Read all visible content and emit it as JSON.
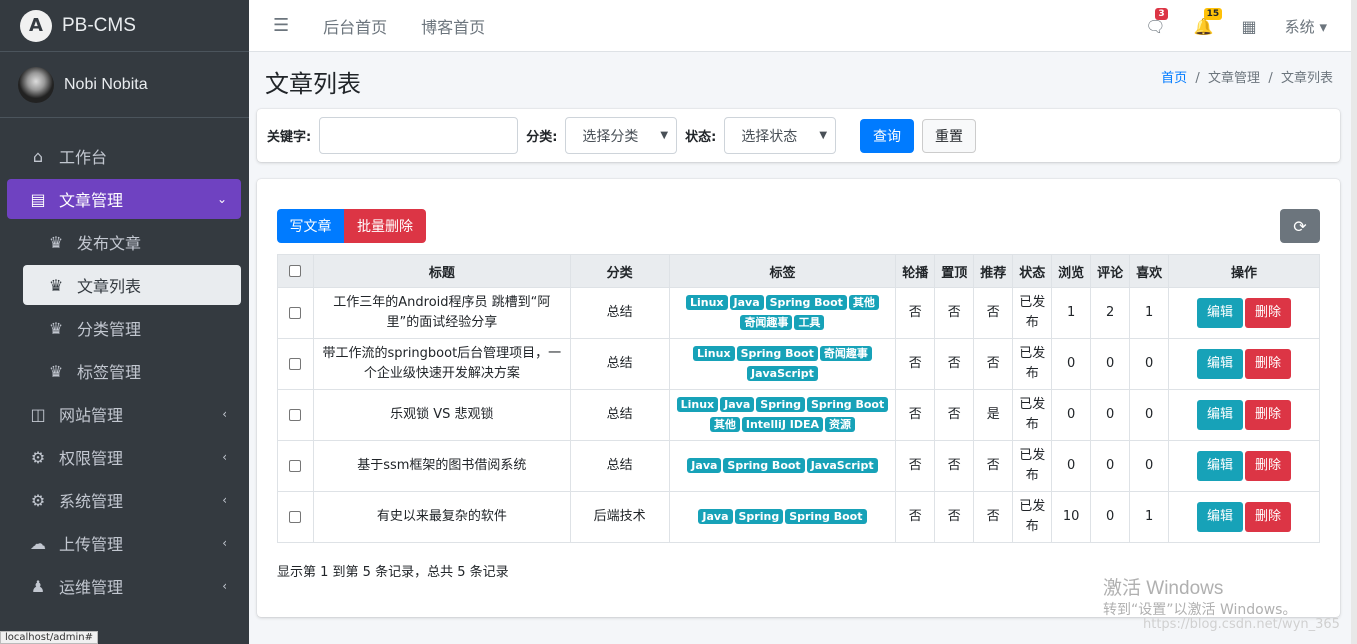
{
  "brand": {
    "name": "PB-CMS"
  },
  "user": {
    "name": "Nobi Nobita"
  },
  "sidebar": {
    "items": [
      {
        "label": "工作台",
        "icon": "home-icon"
      },
      {
        "label": "文章管理",
        "icon": "list-alt-icon"
      },
      {
        "label": "发布文章",
        "icon": "crown-icon"
      },
      {
        "label": "文章列表",
        "icon": "crown-icon"
      },
      {
        "label": "分类管理",
        "icon": "crown-icon"
      },
      {
        "label": "标签管理",
        "icon": "crown-icon"
      },
      {
        "label": "网站管理",
        "icon": "columns-icon"
      },
      {
        "label": "权限管理",
        "icon": "users-cog-icon"
      },
      {
        "label": "系统管理",
        "icon": "gear-icon"
      },
      {
        "label": "上传管理",
        "icon": "cloud-upload-icon"
      },
      {
        "label": "运维管理",
        "icon": "people-carry-icon"
      }
    ]
  },
  "topbar": {
    "links": [
      "后台首页",
      "博客首页"
    ],
    "messages_count": "3",
    "notifications_count": "15",
    "system_label": "系统"
  },
  "page": {
    "title": "文章列表",
    "breadcrumb": [
      "首页",
      "文章管理",
      "文章列表"
    ]
  },
  "filter": {
    "keyword_label": "关键字:",
    "keyword_value": "",
    "category_label": "分类:",
    "category_value": "选择分类",
    "status_label": "状态:",
    "status_value": "选择状态",
    "search_label": "查询",
    "reset_label": "重置"
  },
  "toolbar": {
    "write_label": "写文章",
    "batch_delete_label": "批量删除"
  },
  "table": {
    "headers": [
      "标题",
      "分类",
      "标签",
      "轮播",
      "置顶",
      "推荐",
      "状态",
      "浏览",
      "评论",
      "喜欢",
      "操作"
    ],
    "edit_label": "编辑",
    "delete_label": "删除",
    "rows": [
      {
        "title": "工作三年的Android程序员 跳槽到“阿里”的面试经验分享",
        "category": "总结",
        "tags": [
          "Linux",
          "Java",
          "Spring Boot",
          "其他",
          "奇闻趣事",
          "工具"
        ],
        "carousel": "否",
        "top": "否",
        "recommend": "否",
        "status": "已发布",
        "views": "1",
        "comments": "2",
        "likes": "1"
      },
      {
        "title": "带工作流的springboot后台管理项目，一个企业级快速开发解决方案",
        "category": "总结",
        "tags": [
          "Linux",
          "Spring Boot",
          "奇闻趣事",
          "JavaScript"
        ],
        "carousel": "否",
        "top": "否",
        "recommend": "否",
        "status": "已发布",
        "views": "0",
        "comments": "0",
        "likes": "0"
      },
      {
        "title": "乐观锁 VS 悲观锁",
        "category": "总结",
        "tags": [
          "Linux",
          "Java",
          "Spring",
          "Spring Boot",
          "其他",
          "IntelliJ IDEA",
          "资源"
        ],
        "carousel": "否",
        "top": "否",
        "recommend": "是",
        "status": "已发布",
        "views": "0",
        "comments": "0",
        "likes": "0"
      },
      {
        "title": "基于ssm框架的图书借阅系统",
        "category": "总结",
        "tags": [
          "Java",
          "Spring Boot",
          "JavaScript"
        ],
        "carousel": "否",
        "top": "否",
        "recommend": "否",
        "status": "已发布",
        "views": "0",
        "comments": "0",
        "likes": "0"
      },
      {
        "title": "有史以来最复杂的软件",
        "category": "后端技术",
        "tags": [
          "Java",
          "Spring",
          "Spring Boot"
        ],
        "carousel": "否",
        "top": "否",
        "recommend": "否",
        "status": "已发布",
        "views": "10",
        "comments": "0",
        "likes": "1"
      }
    ],
    "summary": "显示第 1 到第 5 条记录，总共 5 条记录"
  },
  "watermark": {
    "line1": "激活 Windows",
    "line2": "转到“设置”以激活 Windows。",
    "csdn": "https://blog.csdn.net/wyn_365"
  },
  "statusbar": {
    "url": "localhost/admin#"
  }
}
